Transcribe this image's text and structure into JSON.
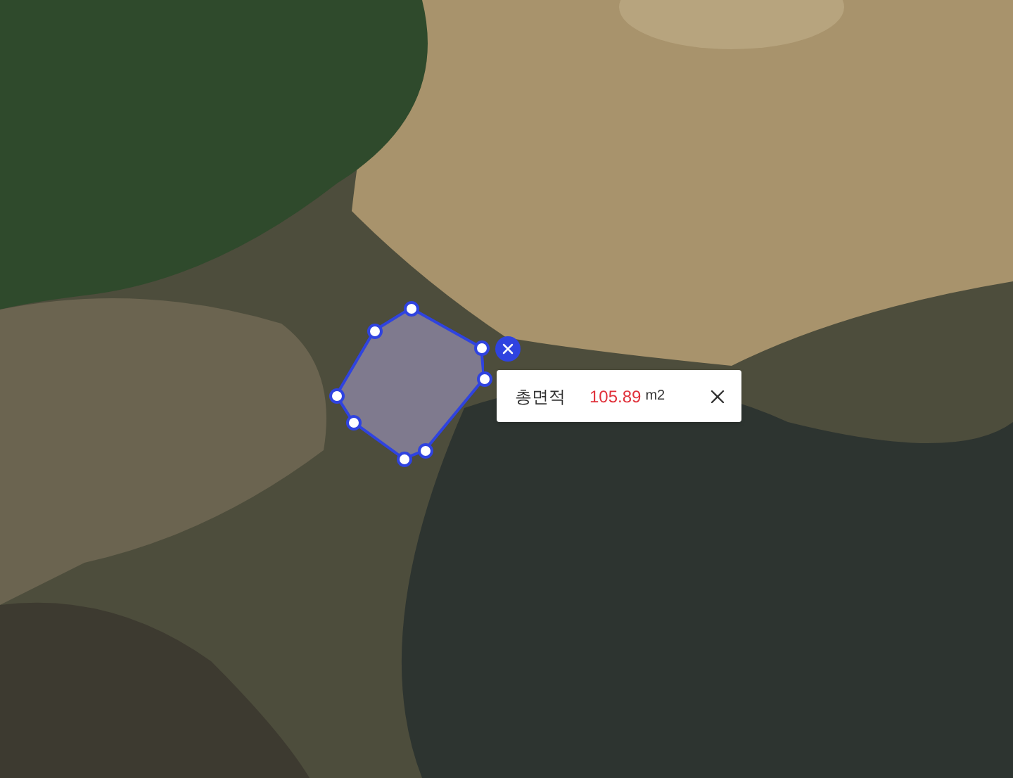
{
  "measurement": {
    "label": "총면적",
    "value": "105.89",
    "unit": "m2"
  }
}
